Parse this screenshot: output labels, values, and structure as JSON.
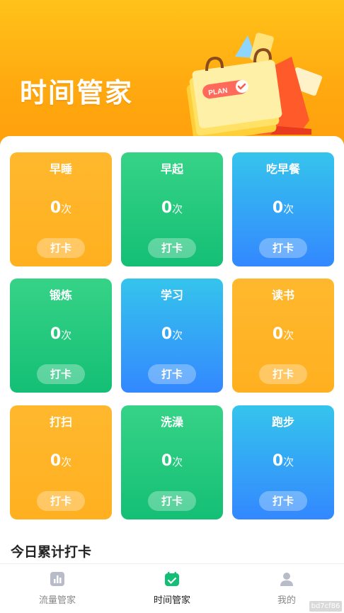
{
  "hero": {
    "title": "时间管家",
    "illustration_label": "PLAN"
  },
  "cards": [
    {
      "title": "早睡",
      "count": "0",
      "unit": "次",
      "button": "打卡",
      "color": "orange"
    },
    {
      "title": "早起",
      "count": "0",
      "unit": "次",
      "button": "打卡",
      "color": "green"
    },
    {
      "title": "吃早餐",
      "count": "0",
      "unit": "次",
      "button": "打卡",
      "color": "blue"
    },
    {
      "title": "锻炼",
      "count": "0",
      "unit": "次",
      "button": "打卡",
      "color": "green"
    },
    {
      "title": "学习",
      "count": "0",
      "unit": "次",
      "button": "打卡",
      "color": "blue"
    },
    {
      "title": "读书",
      "count": "0",
      "unit": "次",
      "button": "打卡",
      "color": "orange"
    },
    {
      "title": "打扫",
      "count": "0",
      "unit": "次",
      "button": "打卡",
      "color": "orange"
    },
    {
      "title": "洗澡",
      "count": "0",
      "unit": "次",
      "button": "打卡",
      "color": "green"
    },
    {
      "title": "跑步",
      "count": "0",
      "unit": "次",
      "button": "打卡",
      "color": "blue"
    }
  ],
  "section": {
    "title": "今日累计打卡"
  },
  "tabbar": {
    "items": [
      {
        "label": "流量管家",
        "icon": "chart-icon"
      },
      {
        "label": "时间管家",
        "icon": "calendar-check-icon"
      },
      {
        "label": "我的",
        "icon": "user-icon"
      }
    ],
    "active_index": 1
  },
  "watermark": "bd7cf86",
  "colors": {
    "orange": "#ffb020",
    "green": "#14bf75",
    "blue": "#3388ff",
    "tab_active": "#14bf75"
  }
}
